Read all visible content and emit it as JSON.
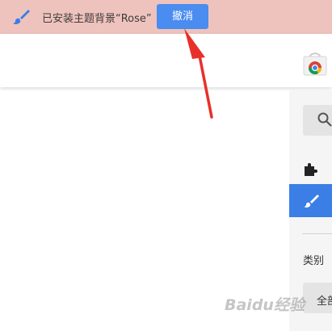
{
  "notification": {
    "message": "已安装主题背景“Rose”",
    "undo_label": "撤消"
  },
  "sidebar": {
    "category_label": "类别",
    "category_value": "全部"
  },
  "watermark": {
    "text": "Baidu经验"
  },
  "colors": {
    "notification_bg": "#efc3bd",
    "accent_blue": "#4a8cf0",
    "annotation_red": "#e8302a"
  }
}
